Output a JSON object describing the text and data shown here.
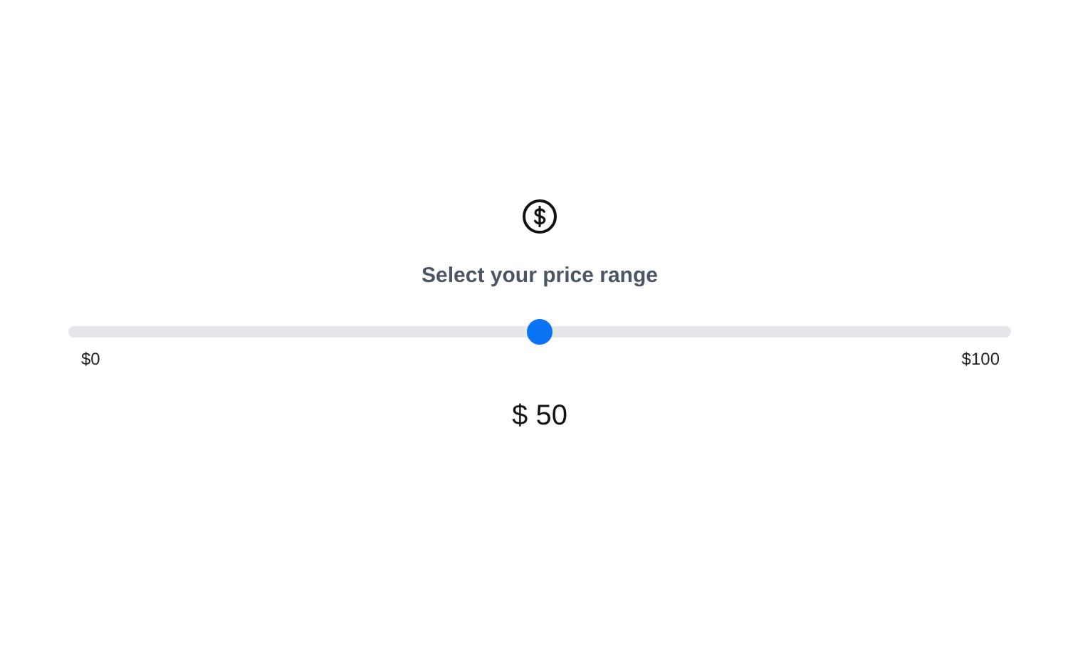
{
  "prompt": "Select your price range",
  "slider": {
    "level": 0.5,
    "min_label": "$0",
    "max_label": "$100"
  },
  "value": "$ 50"
}
